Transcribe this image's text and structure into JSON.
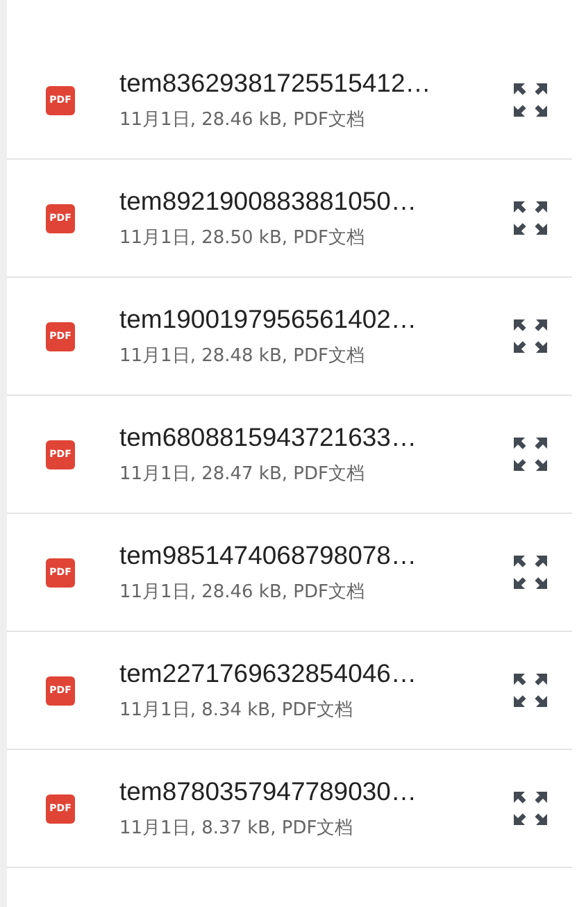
{
  "files": [
    {
      "type_label": "PDF",
      "name": "tem83629381725515412…",
      "details": "11月1日, 28.46 kB, PDF文档"
    },
    {
      "type_label": "PDF",
      "name": "tem8921900883881050…",
      "details": "11月1日, 28.50 kB, PDF文档"
    },
    {
      "type_label": "PDF",
      "name": "tem1900197956561402…",
      "details": "11月1日, 28.48 kB, PDF文档"
    },
    {
      "type_label": "PDF",
      "name": "tem6808815943721633…",
      "details": "11月1日, 28.47 kB, PDF文档"
    },
    {
      "type_label": "PDF",
      "name": "tem9851474068798078…",
      "details": "11月1日, 28.46 kB, PDF文档"
    },
    {
      "type_label": "PDF",
      "name": "tem2271769632854046…",
      "details": "11月1日, 8.34 kB, PDF文档"
    },
    {
      "type_label": "PDF",
      "name": "tem8780357947789030…",
      "details": "11月1日, 8.37 kB, PDF文档"
    }
  ]
}
